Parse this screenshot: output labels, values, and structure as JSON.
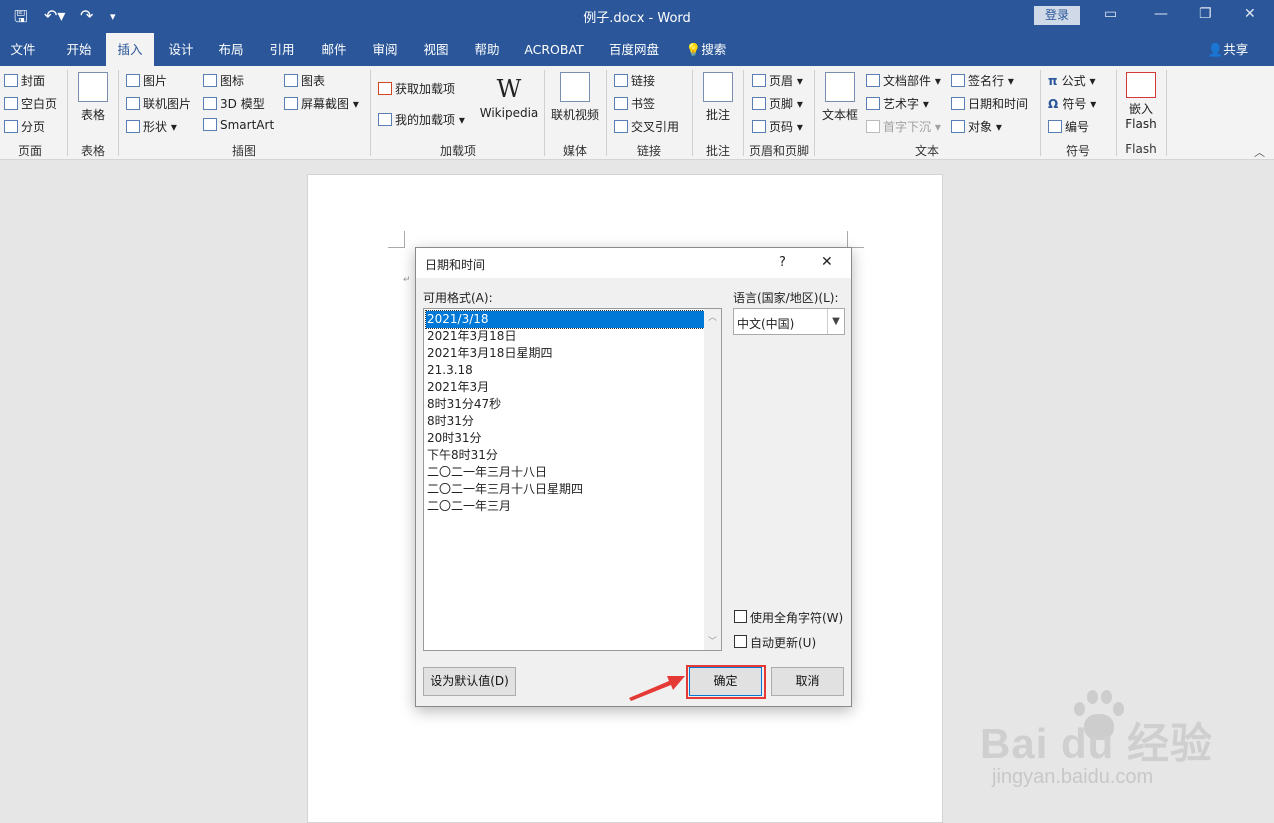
{
  "titlebar": {
    "save_icon": "save-icon",
    "undo_icon": "undo-icon",
    "redo_icon": "redo-icon",
    "customize_icon": "customize-qat-icon",
    "title": "例子.docx  -  Word",
    "login": "登录",
    "ribbon_display_icon": "ribbon-display-icon",
    "minimize_icon": "minimize-icon",
    "restore_icon": "restore-icon",
    "close_icon": "close-icon"
  },
  "tabs": [
    "文件",
    "开始",
    "插入",
    "设计",
    "布局",
    "引用",
    "邮件",
    "审阅",
    "视图",
    "帮助",
    "ACROBAT",
    "百度网盘",
    "搜索"
  ],
  "active_tab": "插入",
  "share": "共享",
  "ribbon": {
    "pages": {
      "cover": "封面",
      "blank": "空白页",
      "break": "分页",
      "label": "页面"
    },
    "tables": {
      "table": "表格",
      "label": "表格"
    },
    "illustrations": {
      "picture": "图片",
      "online_picture": "联机图片",
      "shapes": "形状",
      "icons": "图标",
      "model3d": "3D 模型",
      "smartart": "SmartArt",
      "chart": "图表",
      "screenshot": "屏幕截图",
      "label": "插图"
    },
    "addins": {
      "get": "获取加载项",
      "mine": "我的加载项",
      "wikipedia": "Wikipedia",
      "label": "加载项"
    },
    "media": {
      "online_video": "联机视频",
      "label": "媒体"
    },
    "links": {
      "link": "链接",
      "bookmark": "书签",
      "cross_ref": "交叉引用",
      "label": "链接"
    },
    "comments": {
      "comment": "批注",
      "label": "批注"
    },
    "header_footer": {
      "header": "页眉",
      "footer": "页脚",
      "page_number": "页码",
      "label": "页眉和页脚"
    },
    "text": {
      "textbox": "文本框",
      "quick_parts": "文档部件",
      "wordart": "艺术字",
      "dropcap": "首字下沉",
      "signature": "签名行",
      "datetime": "日期和时间",
      "object": "对象",
      "label": "文本"
    },
    "symbols": {
      "equation": "公式",
      "symbol": "符号",
      "number": "编号",
      "label": "符号"
    },
    "flash": {
      "embed": "嵌入",
      "flash": "Flash",
      "label": "Flash"
    }
  },
  "dialog": {
    "title": "日期和时间",
    "help": "?",
    "close": "✕",
    "formats_label": "可用格式(A):",
    "formats": [
      "2021/3/18",
      "2021年3月18日",
      "2021年3月18日星期四",
      "21.3.18",
      "2021年3月",
      "8时31分47秒",
      "8时31分",
      "20时31分",
      "下午8时31分",
      "二〇二一年三月十八日",
      "二〇二一年三月十八日星期四",
      "二〇二一年三月"
    ],
    "selected_index": 0,
    "language_label": "语言(国家/地区)(L):",
    "language_value": "中文(中国)",
    "fullwidth_label": "使用全角字符(W)",
    "autoupdate_label": "自动更新(U)",
    "default_button": "设为默认值(D)",
    "ok_button": "确定",
    "cancel_button": "取消"
  },
  "watermark": {
    "brand": "Bai du 经验",
    "url": "jingyan.baidu.com"
  },
  "colors": {
    "brand": "#2b579a",
    "selection": "#0078d7",
    "highlight": "#e53935"
  }
}
